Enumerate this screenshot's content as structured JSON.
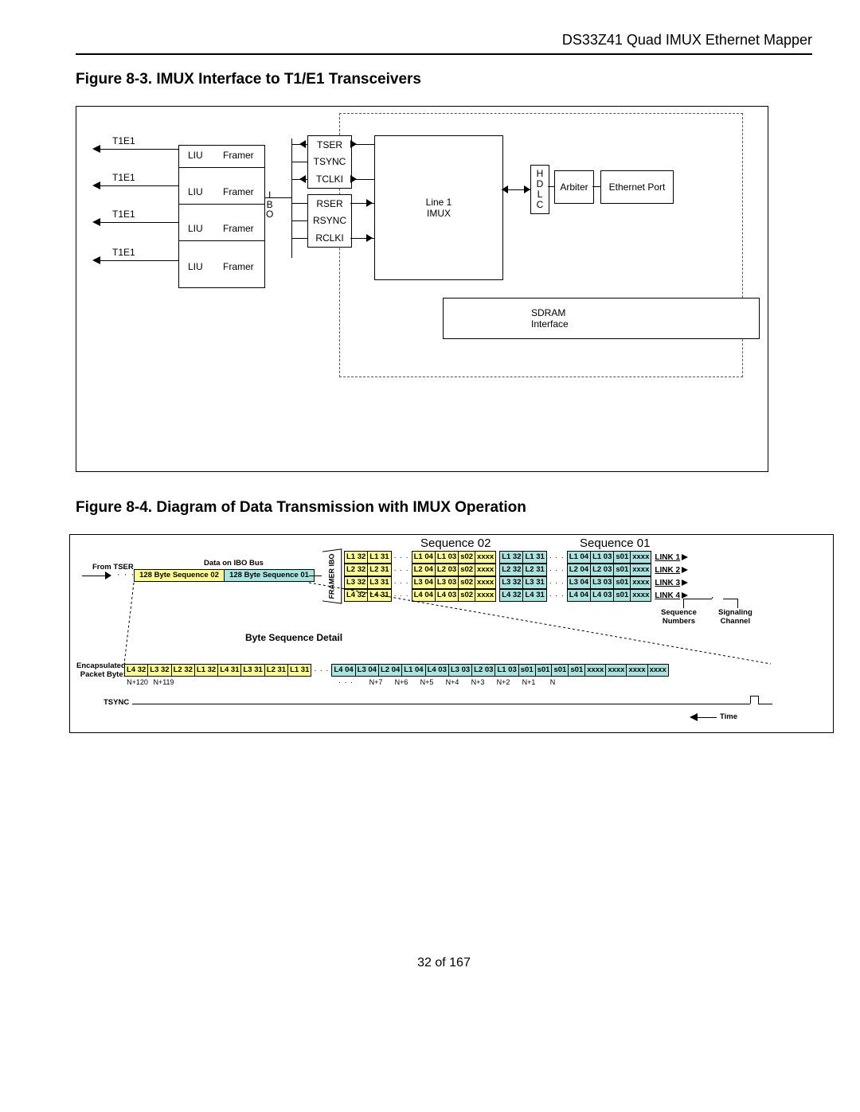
{
  "header": "DS33Z41 Quad IMUX Ethernet Mapper",
  "footer": "32 of 167",
  "fig83": {
    "title": "Figure 8-3. IMUX Interface to T1/E1 Transceivers",
    "t1e1": "T1E1",
    "liu": "LIU",
    "framer": "Framer",
    "ibо": "I\nB\nO",
    "signals": [
      "TSER",
      "TSYNC",
      "TCLKI",
      "RSER",
      "RSYNC",
      "RCLKI"
    ],
    "line1": "Line 1",
    "imux": "IMUX",
    "hdlc": "H\nD\nL\nC",
    "arbiter": "Arbiter",
    "eport": "Ethernet Port",
    "sdram": "SDRAM\nInterface"
  },
  "fig84": {
    "title": "Figure 8-4. Diagram of Data Transmission with IMUX Operation",
    "fromTser": "From TSER",
    "dataOnIbo": "Data on IBO Bus",
    "seqBlocks": [
      "128 Byte Sequence 02",
      "128 Byte Sequence 01"
    ],
    "seq02": "Sequence 02",
    "seq01": "Sequence 01",
    "framerIbo": "FRAMER IBO",
    "lanes": [
      {
        "link": "LINK 1",
        "a": [
          "L1 32",
          "L1 31"
        ],
        "b": [
          "L1 04",
          "L1 03",
          "s02",
          "xxxx"
        ],
        "c": [
          "L1 32",
          "L1 31"
        ],
        "d": [
          "L1 04",
          "L1 03",
          "s01",
          "xxxx"
        ]
      },
      {
        "link": "LINK 2",
        "a": [
          "L2 32",
          "L2 31"
        ],
        "b": [
          "L2 04",
          "L2 03",
          "s02",
          "xxxx"
        ],
        "c": [
          "L2 32",
          "L2 31"
        ],
        "d": [
          "L2 04",
          "L2 03",
          "s01",
          "xxxx"
        ]
      },
      {
        "link": "LINK 3",
        "a": [
          "L3 32",
          "L3 31"
        ],
        "b": [
          "L3 04",
          "L3 03",
          "s02",
          "xxxx"
        ],
        "c": [
          "L3 32",
          "L3 31"
        ],
        "d": [
          "L3 04",
          "L3 03",
          "s01",
          "xxxx"
        ]
      },
      {
        "link": "LINK 4",
        "a": [
          "L4 32",
          "L4 31"
        ],
        "b": [
          "L4 04",
          "L4 03",
          "s02",
          "xxxx"
        ],
        "c": [
          "L4 32",
          "L4 31"
        ],
        "d": [
          "L4 04",
          "L4 03",
          "s01",
          "xxxx"
        ]
      }
    ],
    "seqNums": "Sequence\nNumbers",
    "sigChan": "Signaling\nChannel",
    "byteSeqDetail": "Byte Sequence Detail",
    "encap": "Encapsulated\nPacket Byte:",
    "detailA": [
      "L4 32",
      "L3 32",
      "L2 32",
      "L1 32",
      "L4 31",
      "L3 31",
      "L2 31",
      "L1 31"
    ],
    "detailB": [
      "L4 04",
      "L3 04",
      "L2 04",
      "L1 04",
      "L4 03",
      "L3 03",
      "L2 03",
      "L1 03",
      "s01",
      "s01",
      "s01",
      "s01",
      "xxxx",
      "xxxx",
      "xxxx",
      "xxxx"
    ],
    "packetBytesA": [
      "N+120",
      "N+119"
    ],
    "packetBytesDots": "· · ·",
    "packetBytesB": [
      "N+7",
      "N+6",
      "N+5",
      "N+4",
      "N+3",
      "N+2",
      "N+1",
      "N"
    ],
    "tsync": "TSYNC",
    "time": "Time"
  }
}
